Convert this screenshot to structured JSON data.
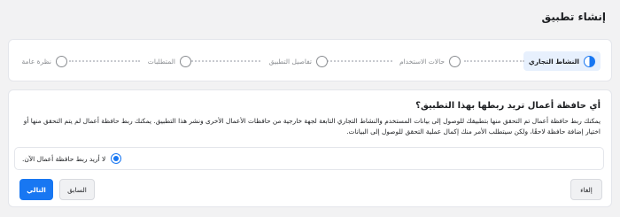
{
  "page": {
    "title": "إنشاء تطبيق"
  },
  "stepper": {
    "steps": [
      {
        "label": "النشاط التجاري",
        "state": "active"
      },
      {
        "label": "حالات الاستخدام",
        "state": "pending"
      },
      {
        "label": "تفاصيل التطبيق",
        "state": "pending"
      },
      {
        "label": "المتطلبات",
        "state": "pending"
      },
      {
        "label": "نظرة عامة",
        "state": "pending"
      }
    ]
  },
  "card": {
    "question": "أي حافظة أعمال تريد ربطها بهذا التطبيق؟",
    "description": "يمكنك ربط حافظة أعمال تم التحقق منها بتطبيقك للوصول إلى بيانات المستخدم والنشاط التجاري التابعة لجهة خارجية من حافظات الأعمال الأخرى ونشر هذا التطبيق. يمكنك ربط حافظة أعمال لم يتم التحقق منها أو اختيار إضافة حافظة لاحقًا، ولكن سيتطلب الأمر منك إكمال عملية التحقق للوصول إلى البيانات.",
    "option_label": "لا أريد ربط حافظة أعمال الآن."
  },
  "buttons": {
    "cancel": "إلغاء",
    "previous": "السابق",
    "next": "التالي"
  },
  "colors": {
    "accent": "#1877f2",
    "active_step_bg": "#e7f0fd"
  }
}
